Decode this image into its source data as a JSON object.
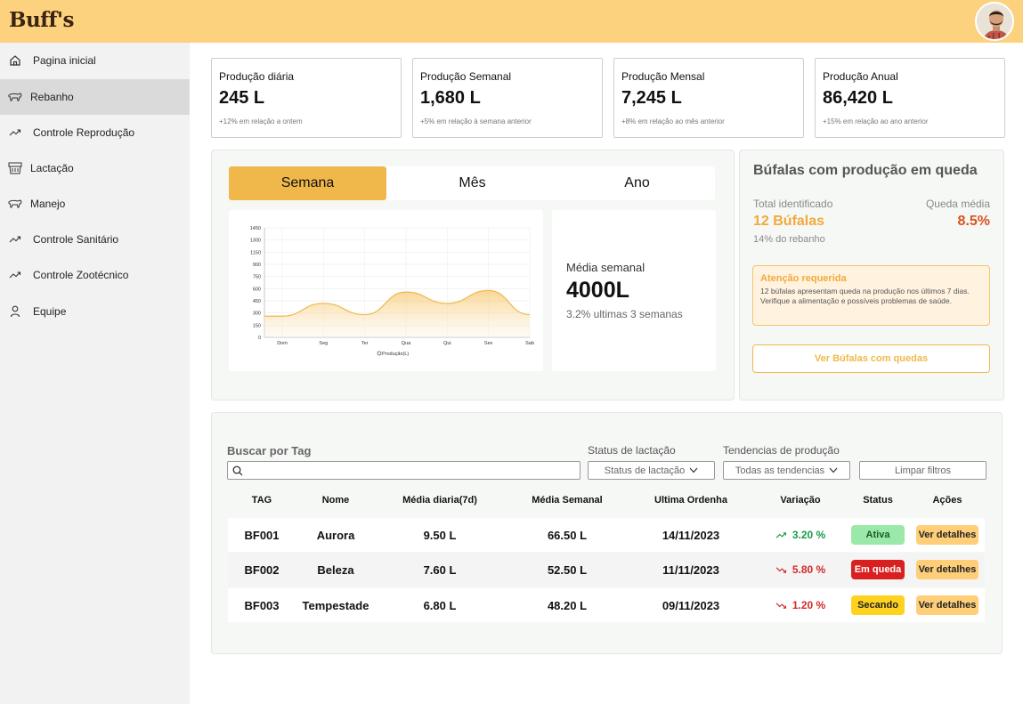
{
  "header": {
    "logo": "Buff's"
  },
  "sidebar": {
    "items": [
      {
        "label": "Pagina inicial",
        "icon": "home-icon"
      },
      {
        "label": "Rebanho",
        "icon": "buffalo-icon"
      },
      {
        "label": "Controle Reprodução",
        "icon": "trend-icon"
      },
      {
        "label": "Lactação",
        "icon": "milk-icon"
      },
      {
        "label": "Manejo",
        "icon": "buffalo-icon"
      },
      {
        "label": "Controle Sanitário",
        "icon": "trend-icon"
      },
      {
        "label": "Controle Zootécnico",
        "icon": "trend-icon"
      },
      {
        "label": "Equipe",
        "icon": "person-icon"
      }
    ],
    "active_index": 1
  },
  "kpis": [
    {
      "title": "Produção diária",
      "value": "245 L",
      "delta": "+12% em relação a ontem"
    },
    {
      "title": "Produção Semanal",
      "value": "1,680 L",
      "delta": "+5% em relação à semana anterior"
    },
    {
      "title": "Produção Mensal",
      "value": "7,245 L",
      "delta": "+8% em relação ao mês anterior"
    },
    {
      "title": "Produção Anual",
      "value": "86,420 L",
      "delta": "+15% em relação ao ano anterior"
    }
  ],
  "production": {
    "tabs": [
      "Semana",
      "Mês",
      "Ano"
    ],
    "active_tab": 0,
    "weekly": {
      "label": "Média semanal",
      "value": "4000L",
      "sub": "3.2% ultimas 3 semanas"
    }
  },
  "chart_data": {
    "type": "area",
    "categories": [
      "Dom",
      "Seg",
      "Ter",
      "Qua",
      "Qui",
      "Sex",
      "Sab"
    ],
    "series": [
      {
        "name": "Produção(L)",
        "values": [
          280,
          450,
          300,
          600,
          450,
          620,
          300
        ]
      }
    ],
    "x": [
      0,
      1,
      2,
      3,
      4,
      5,
      6
    ],
    "yticks": [
      0,
      150,
      300,
      450,
      600,
      750,
      900,
      1150,
      1300,
      1450
    ],
    "ylim": [
      0,
      1450
    ],
    "grid": true,
    "legend": "bottom",
    "color": "#f0b84b"
  },
  "drop": {
    "title": "Búfalas com produção em queda",
    "total_label": "Total identificado",
    "avg_label": "Queda média",
    "total_value": "12 Búfalas",
    "avg_value": "8.5%",
    "herd_share": "14% do rebanho",
    "alert_title": "Atenção requerida",
    "alert_text": "12 búfalas apresentam queda na produção nos últimos 7 dias. Verifique a alimentação e possíveis problemas de saúde.",
    "button": "Ver Búfalas com quedas"
  },
  "filters": {
    "search_label": "Buscar por Tag",
    "status_label": "Status de lactação",
    "status_value": "Status de lactação",
    "trend_label": "Tendencias de produção",
    "trend_value": "Todas as tendencias",
    "clear_button": "Limpar filtros"
  },
  "table": {
    "headers": [
      "TAG",
      "Nome",
      "Média diaria(7d)",
      "Média Semanal",
      "Ultima Ordenha",
      "Variação",
      "Status",
      "Ações"
    ],
    "rows": [
      {
        "tag": "BF001",
        "name": "Aurora",
        "daily": "9.50 L",
        "weekly": "66.50 L",
        "last": "14/11/2023",
        "variation": "3.20 %",
        "trend": "up",
        "status": "Ativa",
        "status_bg": "#9be9a8",
        "status_fg": "#1a5a2a",
        "action": "Ver detalhes"
      },
      {
        "tag": "BF002",
        "name": "Beleza",
        "daily": "7.60 L",
        "weekly": "52.50 L",
        "last": "11/11/2023",
        "variation": "5.80 %",
        "trend": "down",
        "status": "Em queda",
        "status_bg": "#d92020",
        "status_fg": "#ffffff",
        "action": "Ver detalhes"
      },
      {
        "tag": "BF003",
        "name": "Tempestade",
        "daily": "6.80 L",
        "weekly": "48.20 L",
        "last": "09/11/2023",
        "variation": "1.20 %",
        "trend": "down",
        "status": "Secando",
        "status_bg": "#ffd21f",
        "status_fg": "#222222",
        "action": "Ver detalhes"
      }
    ]
  }
}
